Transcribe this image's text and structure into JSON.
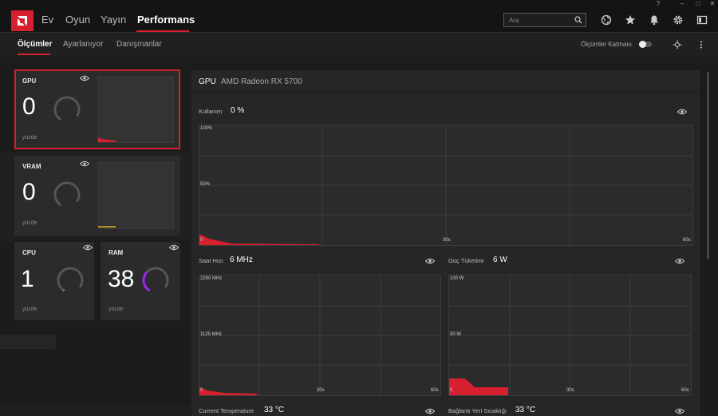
{
  "nav": {
    "tabs": [
      {
        "label": "Ev"
      },
      {
        "label": "Oyun"
      },
      {
        "label": "Yayın"
      },
      {
        "label": "Performans"
      }
    ],
    "search_placeholder": "Ara"
  },
  "subnav": {
    "tabs": [
      {
        "label": "Ölçümler"
      },
      {
        "label": "Ayarlanıyor"
      },
      {
        "label": "Danışmanlar"
      }
    ],
    "overlay_label": "Ölçümler Katmanı"
  },
  "cards": {
    "gpu": {
      "label": "GPU",
      "value": "0",
      "unit": "yüzde"
    },
    "vram": {
      "label": "VRAM",
      "value": "0",
      "unit": "yüzde"
    },
    "cpu": {
      "label": "CPU",
      "value": "1",
      "unit": "yüzde"
    },
    "ram": {
      "label": "RAM",
      "value": "38",
      "unit": "yüzde"
    }
  },
  "panel": {
    "title": "GPU",
    "device": "AMD Radeon RX 5700",
    "usage": {
      "label": "Kullanım",
      "value": "0 %",
      "ymax": "100%",
      "ymid": "50%",
      "ymin": "0",
      "xmid": "30s",
      "xmax": "60s"
    },
    "clock": {
      "label": "Saat Hızı",
      "value": "6 MHz",
      "ymax": "2250 MHz",
      "ymid": "1125 MHz",
      "ymin": "0",
      "xmid": "30s",
      "xmax": "60s"
    },
    "power": {
      "label": "Güç Tüketimi",
      "value": "6 W",
      "ymax": "100 W",
      "ymid": "50 W",
      "ymin": "0",
      "xmid": "30s",
      "xmax": "60s"
    },
    "temp": {
      "label": "Current Temperature",
      "value": "33 °C"
    },
    "junction": {
      "label": "Bağlantı Yeri Sıcaklığı",
      "value": "33 °C"
    }
  },
  "colors": {
    "accent": "#d6202f",
    "vram_line": "#e0b020",
    "ram_ring": "#a020f0",
    "cpu_ring": "#3cc040"
  }
}
